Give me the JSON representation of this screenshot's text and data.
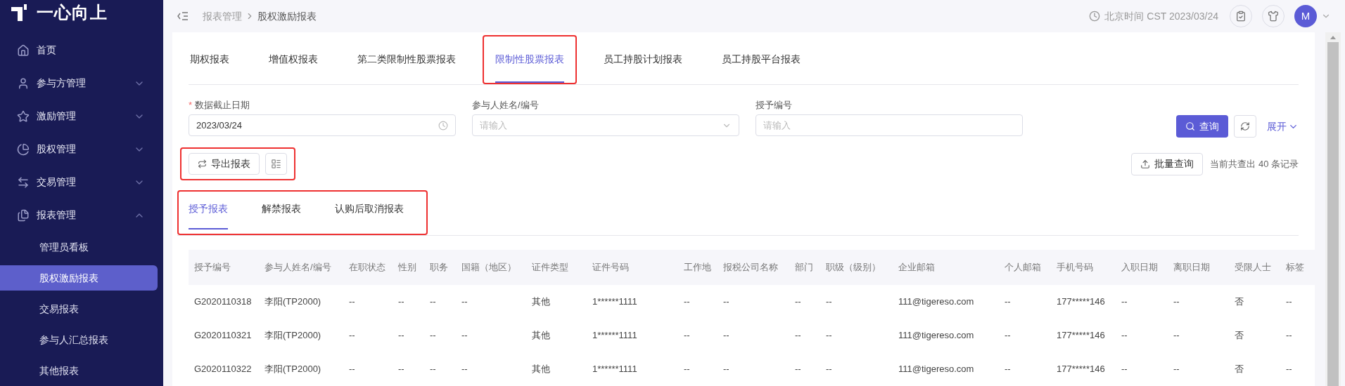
{
  "brand": {
    "name": "一心向上"
  },
  "sidebar": {
    "items": [
      {
        "label": "首页",
        "kind": "link"
      },
      {
        "label": "参与方管理",
        "kind": "group",
        "expanded": false
      },
      {
        "label": "激励管理",
        "kind": "group",
        "expanded": false
      },
      {
        "label": "股权管理",
        "kind": "group",
        "expanded": false
      },
      {
        "label": "交易管理",
        "kind": "group",
        "expanded": false
      },
      {
        "label": "报表管理",
        "kind": "group",
        "expanded": true,
        "children": [
          {
            "label": "管理员看板",
            "selected": false
          },
          {
            "label": "股权激励报表",
            "selected": true
          },
          {
            "label": "交易报表",
            "selected": false
          },
          {
            "label": "参与人汇总报表",
            "selected": false
          },
          {
            "label": "其他报表",
            "selected": false
          }
        ]
      }
    ]
  },
  "breadcrumb": [
    "报表管理",
    "股权激励报表"
  ],
  "header": {
    "time": "北京时间 CST 2023/03/24",
    "avatar": "M"
  },
  "report_tabs": [
    {
      "label": "期权报表",
      "selected": false,
      "highlighted": false
    },
    {
      "label": "增值权报表",
      "selected": false,
      "highlighted": false
    },
    {
      "label": "第二类限制性股票报表",
      "selected": false,
      "highlighted": false
    },
    {
      "label": "限制性股票报表",
      "selected": true,
      "highlighted": true
    },
    {
      "label": "员工持股计划报表",
      "selected": false,
      "highlighted": false
    },
    {
      "label": "员工持股平台报表",
      "selected": false,
      "highlighted": false
    }
  ],
  "filters": [
    {
      "kind": "date",
      "required_mark": "*",
      "label": "数据截止日期",
      "value": "2023/03/24"
    },
    {
      "kind": "select",
      "label": "参与人姓名/编号",
      "placeholder": "请输入"
    },
    {
      "kind": "text",
      "label": "授予编号",
      "placeholder": "请输入"
    }
  ],
  "query_button": "查询",
  "expand_link": "展开",
  "toolbar": {
    "highlighted": true,
    "export_button": "导出报表",
    "batch_button": "批量查询",
    "record_count": "当前共查出 40 条记录"
  },
  "sub_tabs": {
    "highlighted": true,
    "items": [
      {
        "label": "授予报表",
        "selected": true
      },
      {
        "label": "解禁报表",
        "selected": false
      },
      {
        "label": "认购后取消报表",
        "selected": false
      }
    ]
  },
  "table": {
    "columns": [
      "授予编号",
      "参与人姓名/编号",
      "在职状态",
      "性别",
      "职务",
      "国籍（地区）",
      "证件类型",
      "证件号码",
      "工作地",
      "报税公司名称",
      "部门",
      "职级（级别）",
      "企业邮箱",
      "个人邮箱",
      "手机号码",
      "入职日期",
      "离职日期",
      "受限人士",
      "标签"
    ],
    "rows": [
      [
        "G2020110318",
        "李阳(TP2000)",
        "--",
        "--",
        "--",
        "--",
        "其他",
        "1******1111",
        "--",
        "--",
        "--",
        "--",
        "111@tigereso.com",
        "--",
        "177*****146",
        "--",
        "--",
        "否",
        "--"
      ],
      [
        "G2020110321",
        "李阳(TP2000)",
        "--",
        "--",
        "--",
        "--",
        "其他",
        "1******1111",
        "--",
        "--",
        "--",
        "--",
        "111@tigereso.com",
        "--",
        "177*****146",
        "--",
        "--",
        "否",
        "--"
      ],
      [
        "G2020110322",
        "李阳(TP2000)",
        "--",
        "--",
        "--",
        "--",
        "其他",
        "1******1111",
        "--",
        "--",
        "--",
        "--",
        "111@tigereso.com",
        "--",
        "177*****146",
        "--",
        "--",
        "否",
        "--"
      ]
    ]
  }
}
